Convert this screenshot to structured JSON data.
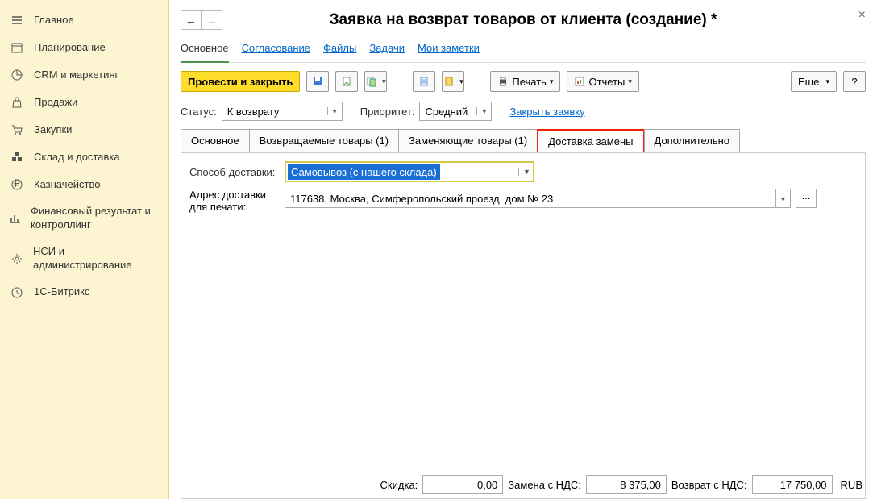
{
  "sidebar": [
    {
      "label": "Главное"
    },
    {
      "label": "Планирование"
    },
    {
      "label": "CRM и маркетинг"
    },
    {
      "label": "Продажи"
    },
    {
      "label": "Закупки"
    },
    {
      "label": "Склад и доставка"
    },
    {
      "label": "Казначейство"
    },
    {
      "label": "Финансовый результат и контроллинг"
    },
    {
      "label": "НСИ и администрирование"
    },
    {
      "label": "1С-Битрикс"
    }
  ],
  "title": "Заявка на возврат товаров от клиента (создание) *",
  "navTabs": [
    {
      "label": "Основное",
      "active": true
    },
    {
      "label": "Согласование"
    },
    {
      "label": "Файлы"
    },
    {
      "label": "Задачи"
    },
    {
      "label": "Мои заметки"
    }
  ],
  "toolbar": {
    "main": "Провести и закрыть",
    "print": "Печать",
    "reports": "Отчеты",
    "more": "Еще"
  },
  "status": {
    "lbl": "Статус:",
    "val": "К возврату"
  },
  "priority": {
    "lbl": "Приоритет:",
    "val": "Средний"
  },
  "closeLink": "Закрыть заявку",
  "docTabs": [
    "Основное",
    "Возвращаемые товары (1)",
    "Заменяющие товары (1)",
    "Доставка замены",
    "Дополнительно"
  ],
  "delivery": {
    "lbl": "Способ доставки:",
    "val": "Самовывоз (с нашего склада)"
  },
  "address": {
    "lbl1": "Адрес доставки",
    "lbl2": "для печати:",
    "val": "117638, Москва, Симферопольский проезд, дом № 23"
  },
  "footer": {
    "discount": {
      "lbl": "Скидка:",
      "val": "0,00"
    },
    "replace": {
      "lbl": "Замена с НДС:",
      "val": "8 375,00"
    },
    "return": {
      "lbl": "Возврат с НДС:",
      "val": "17 750,00"
    },
    "cur": "RUB"
  },
  "help": "?"
}
